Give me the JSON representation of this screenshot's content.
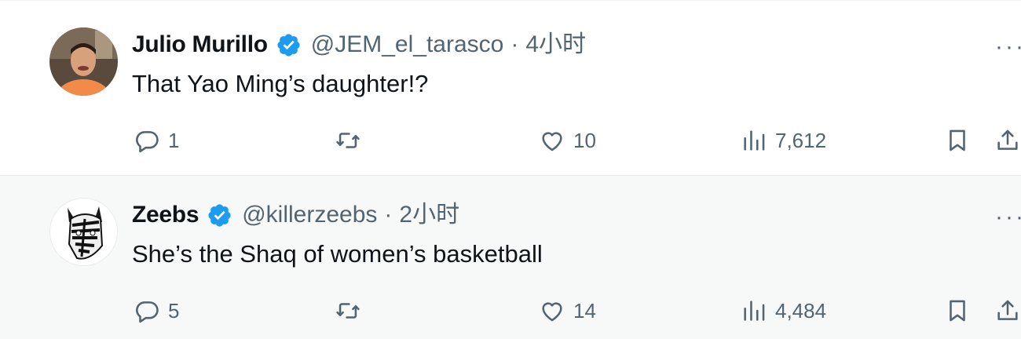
{
  "tweets": [
    {
      "name": "Julio Murillo",
      "handle": "@JEM_el_tarasco",
      "separator": "·",
      "time": "4小时",
      "text": "That Yao Ming’s daughter!?",
      "replies": "1",
      "retweets": "",
      "likes": "10",
      "views": "7,612",
      "more": "···"
    },
    {
      "name": "Zeebs",
      "handle": "@killerzeebs",
      "separator": "·",
      "time": "2小时",
      "text": "She’s the Shaq of women’s basketball",
      "replies": "5",
      "retweets": "",
      "likes": "14",
      "views": "4,484",
      "more": "···"
    }
  ],
  "colors": {
    "verified_badge": "#1d9bf0",
    "secondary_text": "#536471",
    "primary_text": "#0f1419"
  },
  "icons": {
    "reply": "reply-icon",
    "retweet": "retweet-icon",
    "like": "heart-icon",
    "views": "views-chart-icon",
    "bookmark": "bookmark-icon",
    "share": "share-icon",
    "verified": "verified-badge-icon",
    "more": "more-options-icon"
  }
}
